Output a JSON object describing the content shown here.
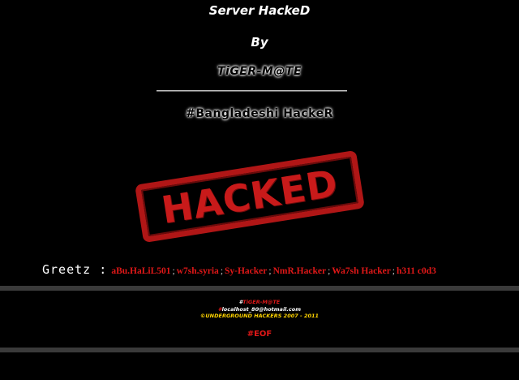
{
  "header": {
    "title": "Server HackeD",
    "by": "By",
    "author": "TiGER-M@TE",
    "tagline": "#Bangladeshi HackeR"
  },
  "stamp": {
    "text": "HACKED",
    "color": "#c81a1a"
  },
  "greetz": {
    "label": "Greetz :",
    "names": [
      "aBu.HaLiL501",
      "w7sh.syria",
      "Sy-Hacker",
      "NmR.Hacker",
      "Wa7sh Hacker",
      "h311 c0d3"
    ],
    "separator": ";"
  },
  "footer": {
    "author_hash": "#",
    "author": "TiGER-M@TE",
    "email_hash": "#",
    "email": "localhost_80@hotmail.com",
    "copyright": "©UNDERGROUND HACKERS 2007 - 2011",
    "eof": "#EOF"
  },
  "colors": {
    "background": "#000000",
    "accent_red": "#e01818",
    "yellow": "#ffd400",
    "bar": "#3a3a3a"
  }
}
